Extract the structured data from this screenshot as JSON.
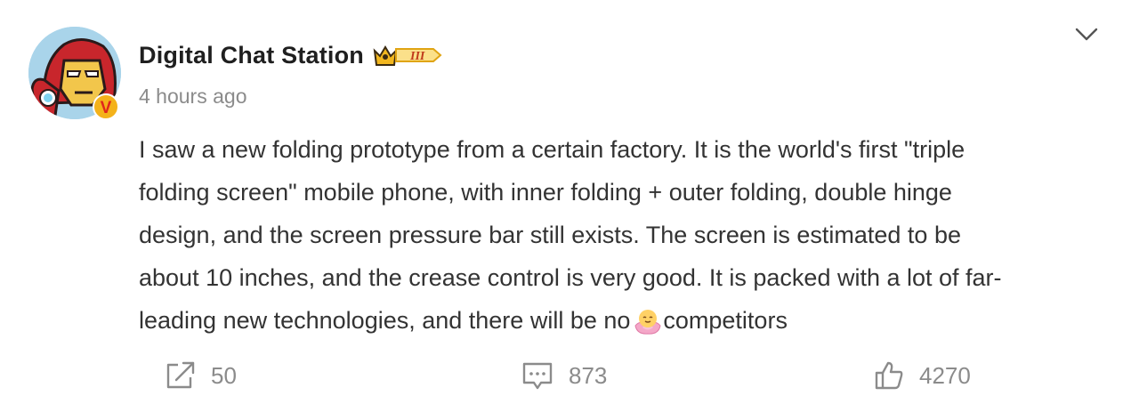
{
  "post": {
    "author_name": "Digital Chat Station",
    "rank_badge": "III",
    "verified_badge": "V",
    "timestamp": "4 hours ago",
    "lines": [
      "I saw a new folding prototype from a certain factory. It is the world's first \"triple",
      "folding screen\" mobile phone, with inner folding + outer folding, double hinge",
      "design, and the screen pressure bar still exists. The screen is estimated to be",
      "about 10 inches, and the crease control is very good. It is packed with a lot of far-",
      "leading new technologies, and there will be no"
    ],
    "last_line_tail": "competitors",
    "inline_emoji": "lotus-emoji"
  },
  "actions": {
    "repost_count": "50",
    "comment_count": "873",
    "like_count": "4270"
  },
  "icons": {
    "menu": "chevron-down-icon",
    "repost": "share-icon",
    "comment": "comment-icon",
    "like": "thumbs-up-icon"
  },
  "colors": {
    "text": "#333333",
    "muted": "#8b8b8b",
    "badge_gold": "#f4b21a",
    "badge_red": "#e0261c"
  }
}
